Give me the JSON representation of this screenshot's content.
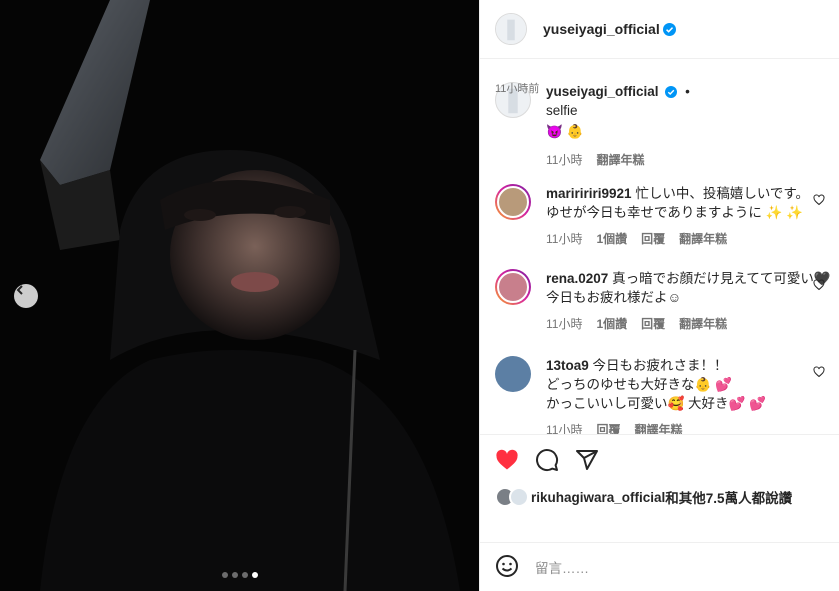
{
  "post": {
    "author": "yuseiyagi_official",
    "caption_author": "yuseiyagi_official",
    "caption_dot": "•",
    "caption_text": "selfie",
    "caption_emoji": "😈 👶",
    "caption_time": "11小時",
    "caption_translate": "翻譯年糕"
  },
  "comments": [
    {
      "user": "mariririri9921",
      "text_line1": " 忙しい中、投稿嬉しいです。",
      "text_line2": "ゆせが今日も幸せでありますように ✨ ✨",
      "time": "11小時",
      "likes": "1個讚",
      "reply": "回覆",
      "translate": "翻譯年糕"
    },
    {
      "user": "rena.0207",
      "text_line1": " 真っ暗でお顔だけ見えてて可愛い🖤",
      "text_line2": "今日もお疲れ様だよ☺︎",
      "time": "11小時",
      "likes": "1個讚",
      "reply": "回覆",
      "translate": "翻譯年糕"
    },
    {
      "user": "13toa9",
      "text_line1": " 今日もお疲れさま！！",
      "text_line2": "どっちのゆせも大好きな👶 💕",
      "text_line3": "かっこいいし可愛い🥰 大好き💕 💕",
      "time": "11小時",
      "reply": "回覆",
      "translate": "翻譯年糕"
    }
  ],
  "likes": {
    "user": "rikuhagiwara_official",
    "suffix": "和其他7.5萬人都說讚"
  },
  "posted_time": "11小時前",
  "composer": {
    "placeholder": "留言……"
  },
  "carousel": {
    "total": 4,
    "active_index": 3
  },
  "colors": {
    "verified": "#0095f6",
    "like_red": "#ff3040",
    "muted": "#737373"
  }
}
